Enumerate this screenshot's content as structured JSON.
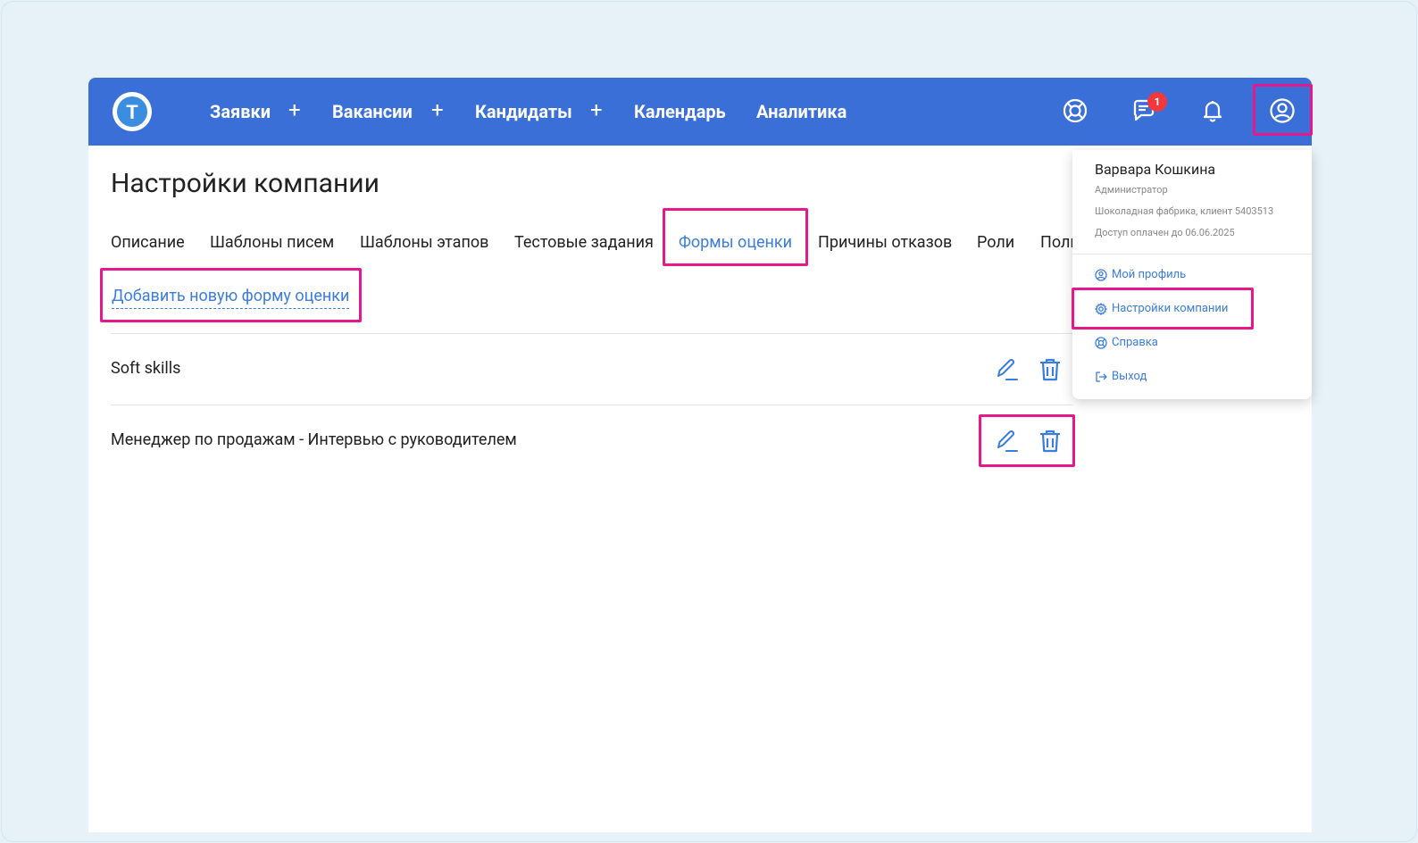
{
  "nav": {
    "items": [
      {
        "label": "Заявки",
        "has_plus": true
      },
      {
        "label": "Вакансии",
        "has_plus": true
      },
      {
        "label": "Кандидаты",
        "has_plus": true
      },
      {
        "label": "Календарь",
        "has_plus": false
      },
      {
        "label": "Аналитика",
        "has_plus": false
      }
    ],
    "plus_symbol": "+",
    "logo_letter": "T",
    "chat_badge_count": "1",
    "icons": [
      "help-lifebuoy-icon",
      "chat-icon",
      "bell-icon",
      "user-profile-icon"
    ]
  },
  "page": {
    "title": "Настройки компании",
    "tabs": [
      {
        "label": "Описание",
        "active": false
      },
      {
        "label": "Шаблоны писем",
        "active": false
      },
      {
        "label": "Шаблоны этапов",
        "active": false
      },
      {
        "label": "Тестовые задания",
        "active": false
      },
      {
        "label": "Формы оценки",
        "active": true
      },
      {
        "label": "Причины отказов",
        "active": false
      },
      {
        "label": "Роли",
        "active": false
      },
      {
        "label": "Поли",
        "active": false
      }
    ],
    "add_link": "Добавить новую форму оценки",
    "forms": [
      {
        "name": "Soft skills"
      },
      {
        "name": "Менеджер по продажам - Интервью с руководителем"
      }
    ]
  },
  "user_menu": {
    "name": "Варвара Кошкина",
    "role": "Администратор",
    "company": "Шоколадная фабрика, клиент 5403513",
    "access": "Доступ оплачен до 06.06.2025",
    "items": [
      {
        "label": "Мой профиль",
        "icon": "user-circle-icon"
      },
      {
        "label": "Настройки компании",
        "icon": "gear-icon"
      },
      {
        "label": "Справка",
        "icon": "lifebuoy-icon"
      },
      {
        "label": "Выход",
        "icon": "logout-icon"
      }
    ]
  },
  "colors": {
    "topbar": "#3b6fd8",
    "accent": "#3b7ddd",
    "highlight": "#e6198c",
    "badge": "#f0383d",
    "background": "#e6f1f8"
  }
}
